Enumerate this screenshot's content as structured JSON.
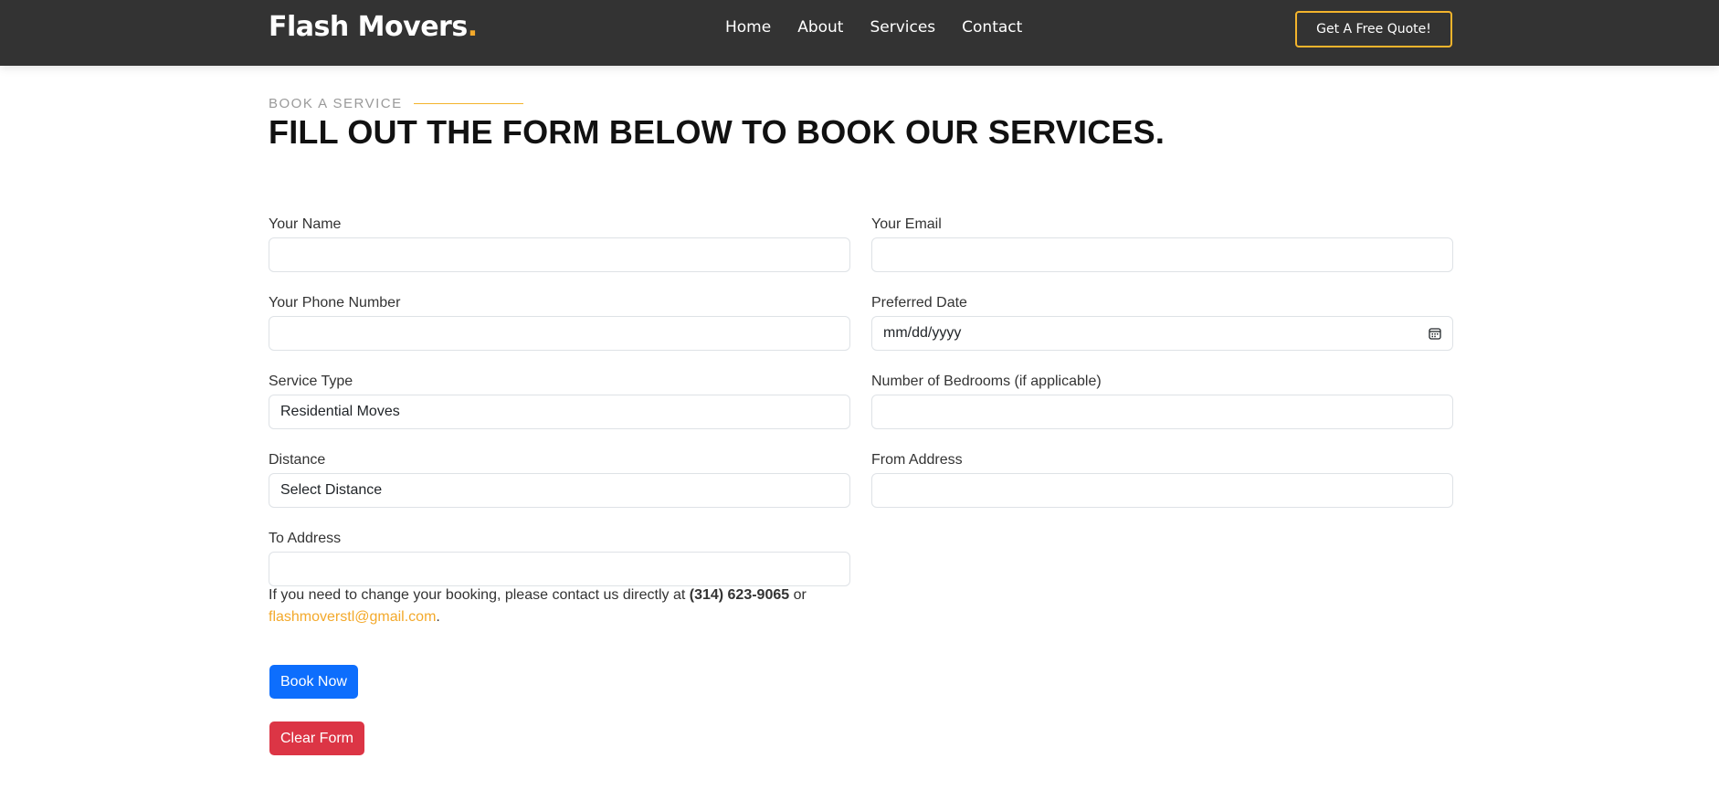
{
  "navbar": {
    "brand": "Flash Movers",
    "brand_dot": ".",
    "links": [
      "Home",
      "About",
      "Services",
      "Contact"
    ],
    "cta": "Get A Free Quote!"
  },
  "section": {
    "eyebrow": "BOOK A SERVICE",
    "heading": "FILL OUT THE FORM BELOW TO BOOK OUR SERVICES."
  },
  "form": {
    "name_label": "Your Name",
    "email_label": "Your Email",
    "phone_label": "Your Phone Number",
    "date_label": "Preferred Date",
    "date_placeholder": "mm/dd/yyyy",
    "service_label": "Service Type",
    "service_value": "Residential Moves",
    "bedrooms_label": "Number of Bedrooms (if applicable)",
    "distance_label": "Distance",
    "distance_value": "Select Distance",
    "from_label": "From Address",
    "to_label": "To Address",
    "note_prefix": "If you need to change your booking, please contact us directly at ",
    "note_phone": "(314) 623-9065",
    "note_middle": " or ",
    "note_email": "flashmoverstl@gmail.com",
    "note_suffix": ".",
    "submit_label": "Book Now",
    "clear_label": "Clear Form"
  },
  "colors": {
    "navbar_bg": "#333333",
    "accent": "#f3a92b",
    "primary": "#0d6efd",
    "danger": "#dc3545"
  },
  "icons": {
    "date": "calendar-icon"
  }
}
